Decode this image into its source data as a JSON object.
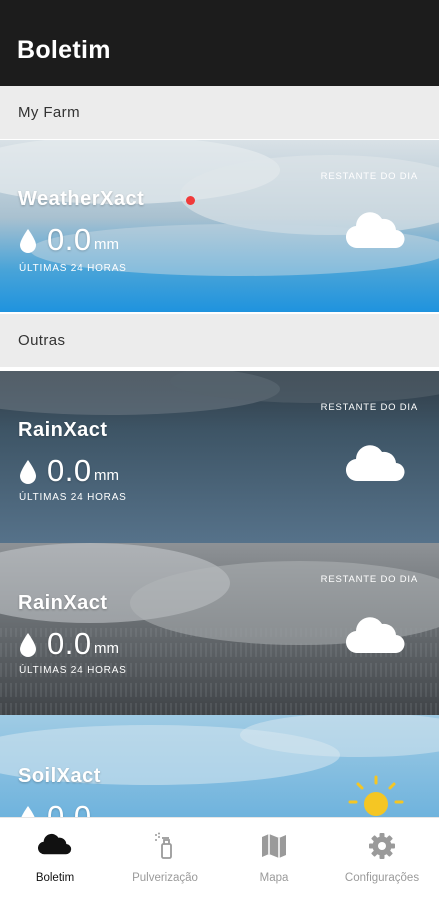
{
  "status_bar": {
    "left": "",
    "right": ""
  },
  "app": {
    "title": "Boletim"
  },
  "sections": {
    "farm": "My Farm",
    "others": "Outras"
  },
  "cards": [
    {
      "name": "WeatherXact",
      "value": "0.0",
      "unit": "mm",
      "period": "ÚLTIMAS 24 HORAS",
      "forecast": "RESTANTE DO DIA",
      "condition": "cloud-icon",
      "alert": true
    },
    {
      "name": "RainXact",
      "value": "0.0",
      "unit": "mm",
      "period": "ÚLTIMAS 24 HORAS",
      "forecast": "RESTANTE DO DIA",
      "condition": "cloud-icon"
    },
    {
      "name": "RainXact",
      "value": "0.0",
      "unit": "mm",
      "period": "ÚLTIMAS 24 HORAS",
      "forecast": "RESTANTE DO DIA",
      "condition": "cloud-icon"
    },
    {
      "name": "SoilXact",
      "value": "0.0",
      "unit": "",
      "period": "",
      "forecast": "",
      "condition": "sun-icon"
    }
  ],
  "nav": [
    {
      "label": "Boletim",
      "icon": "cloud-icon",
      "active": true
    },
    {
      "label": "Pulverização",
      "icon": "sprayer-icon"
    },
    {
      "label": "Mapa",
      "icon": "map-icon"
    },
    {
      "label": "Configurações",
      "icon": "gear-icon"
    }
  ],
  "colors": {
    "alert_dot": "#f03a3a",
    "nav_active": "#111111",
    "nav_inactive": "#9a9a9a",
    "sun": "#f5c623"
  }
}
